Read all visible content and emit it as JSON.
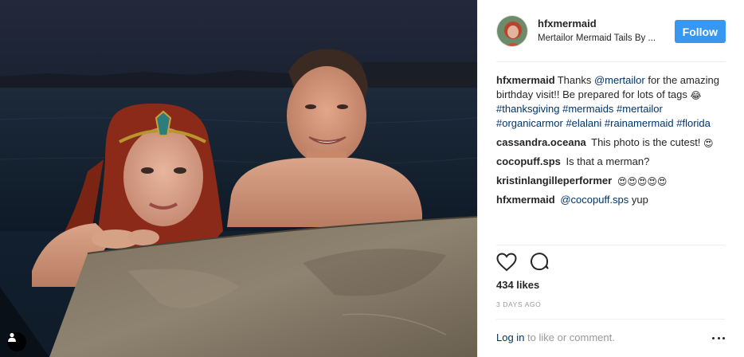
{
  "post": {
    "username": "hfxmermaid",
    "location": "Mertailor Mermaid Tails By ...",
    "follow_label": "Follow",
    "photo_alt": "Photo by hfxmermaid"
  },
  "caption": {
    "username": "hfxmermaid",
    "text": "Thanks ",
    "mention": "@mertailor",
    "text2": " for the amazing birthday visit!! Be prepared for lots of tags ",
    "emoji": "😂",
    "hashtags": [
      "#thanksgiving",
      "#mermaids",
      "#mertailor",
      "#organicarmor",
      "#elalani",
      "#rainamermaid",
      "#florida"
    ]
  },
  "comments": [
    {
      "username": "cassandra.oceana",
      "text": "This photo is the cutest! ",
      "emoji": "😍"
    },
    {
      "username": "cocopuff.sps",
      "text": "Is that a merman?",
      "emoji": ""
    },
    {
      "username": "kristinlangilleperformer",
      "text": "",
      "emoji": "😍😍😍😍😍"
    },
    {
      "username": "hfxmermaid",
      "mention": "@cocopuff.sps",
      "text": " yup",
      "emoji": ""
    }
  ],
  "actions": {
    "like_icon": "heart-icon",
    "comment_icon": "comment-icon"
  },
  "likes_label": "434 likes",
  "timestamp": "3 DAYS AGO",
  "footer": {
    "login_link": "Log in",
    "login_text": " to like or comment.",
    "more_icon": "ellipsis-icon"
  },
  "colors": {
    "follow_button": "#3897f0",
    "link": "#003569",
    "muted": "#999999"
  }
}
